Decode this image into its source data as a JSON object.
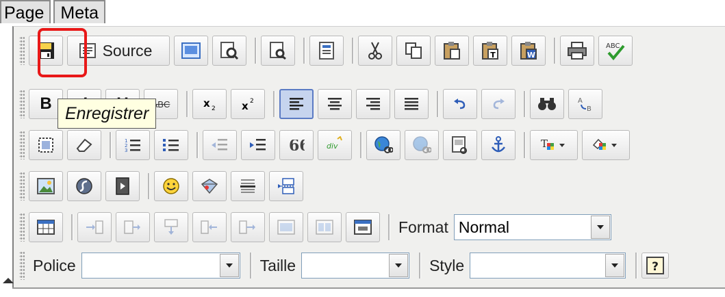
{
  "tabs": [
    {
      "label": "Page"
    },
    {
      "label": "Meta"
    }
  ],
  "toolbar": {
    "source_label": "Source",
    "tooltip": "Enregistrer",
    "strike_label": "ABC",
    "format": {
      "label": "Format",
      "value": "Normal"
    },
    "police": {
      "label": "Police",
      "value": ""
    },
    "taille": {
      "label": "Taille",
      "value": ""
    },
    "style": {
      "label": "Style",
      "value": ""
    }
  },
  "colors": {
    "highlight": "#e81818",
    "tooltip_bg": "#ffffe1",
    "active_bg": "#c6d4ee"
  }
}
